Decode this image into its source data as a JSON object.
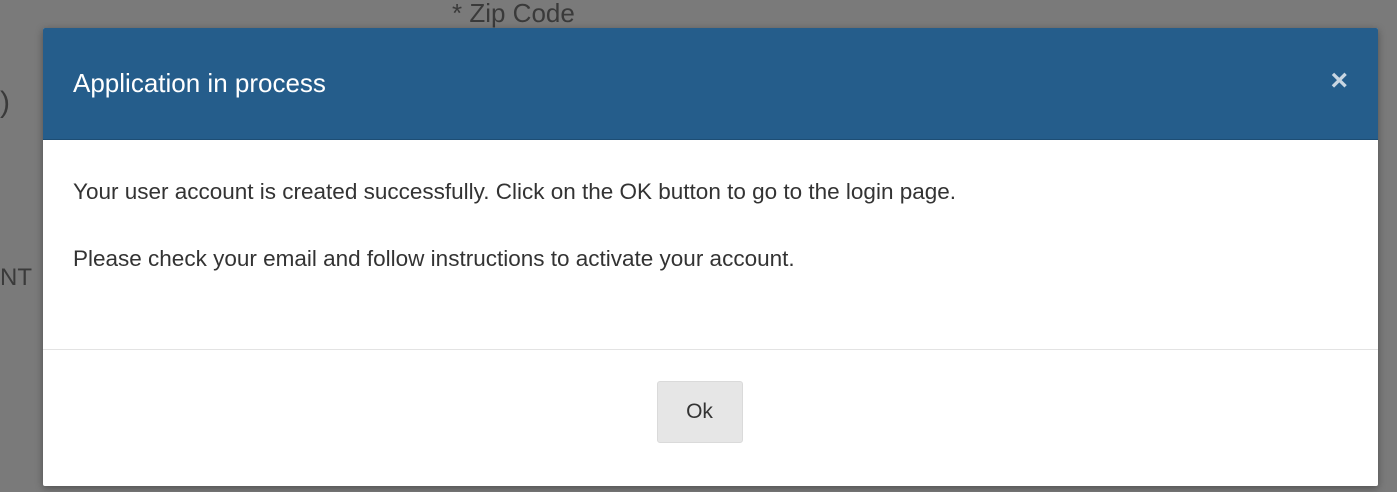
{
  "background": {
    "zip_label": "* Zip Code",
    "left_paren": ")",
    "left_partial": "NT"
  },
  "dialog": {
    "title": "Application in process",
    "close_glyph": "×",
    "messages": [
      "Your user account is created successfully. Click on the OK button to go to the login page.",
      "Please check your email and follow instructions to activate your account."
    ],
    "ok_label": "Ok"
  },
  "colors": {
    "header_bg": "#255d8b",
    "overlay": "#7a7a7a",
    "button_bg": "#e6e6e6"
  }
}
